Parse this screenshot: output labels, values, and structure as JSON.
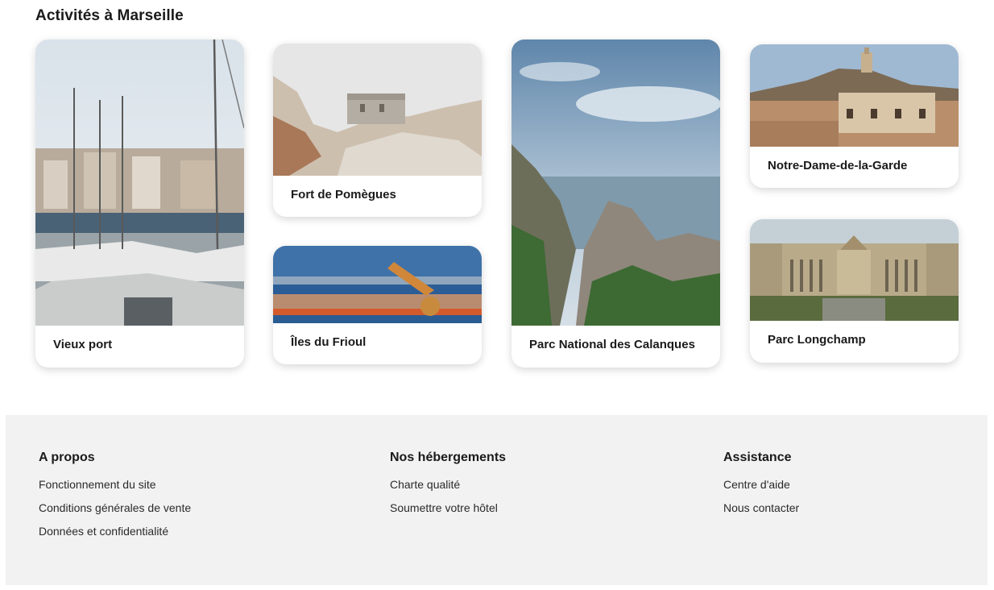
{
  "section": {
    "title": "Activités à Marseille"
  },
  "cards": [
    {
      "label": "Vieux port",
      "image": "marina-photo"
    },
    {
      "label": "Fort de Pomègues",
      "image": "fort-photo"
    },
    {
      "label": "Îles du Frioul",
      "image": "islands-photo"
    },
    {
      "label": "Parc National des Calanques",
      "image": "calanques-photo"
    },
    {
      "label": "Notre-Dame-de-la-Garde",
      "image": "basilica-photo"
    },
    {
      "label": "Parc Longchamp",
      "image": "palace-photo"
    }
  ],
  "footer": {
    "columns": [
      {
        "title": "A propos",
        "links": [
          "Fonctionnement du site",
          "Conditions générales de vente",
          "Données et confidentialité"
        ]
      },
      {
        "title": "Nos hébergements",
        "links": [
          "Charte qualité",
          "Soumettre votre hôtel"
        ]
      },
      {
        "title": "Assistance",
        "links": [
          "Centre d'aide",
          "Nous contacter"
        ]
      }
    ]
  }
}
